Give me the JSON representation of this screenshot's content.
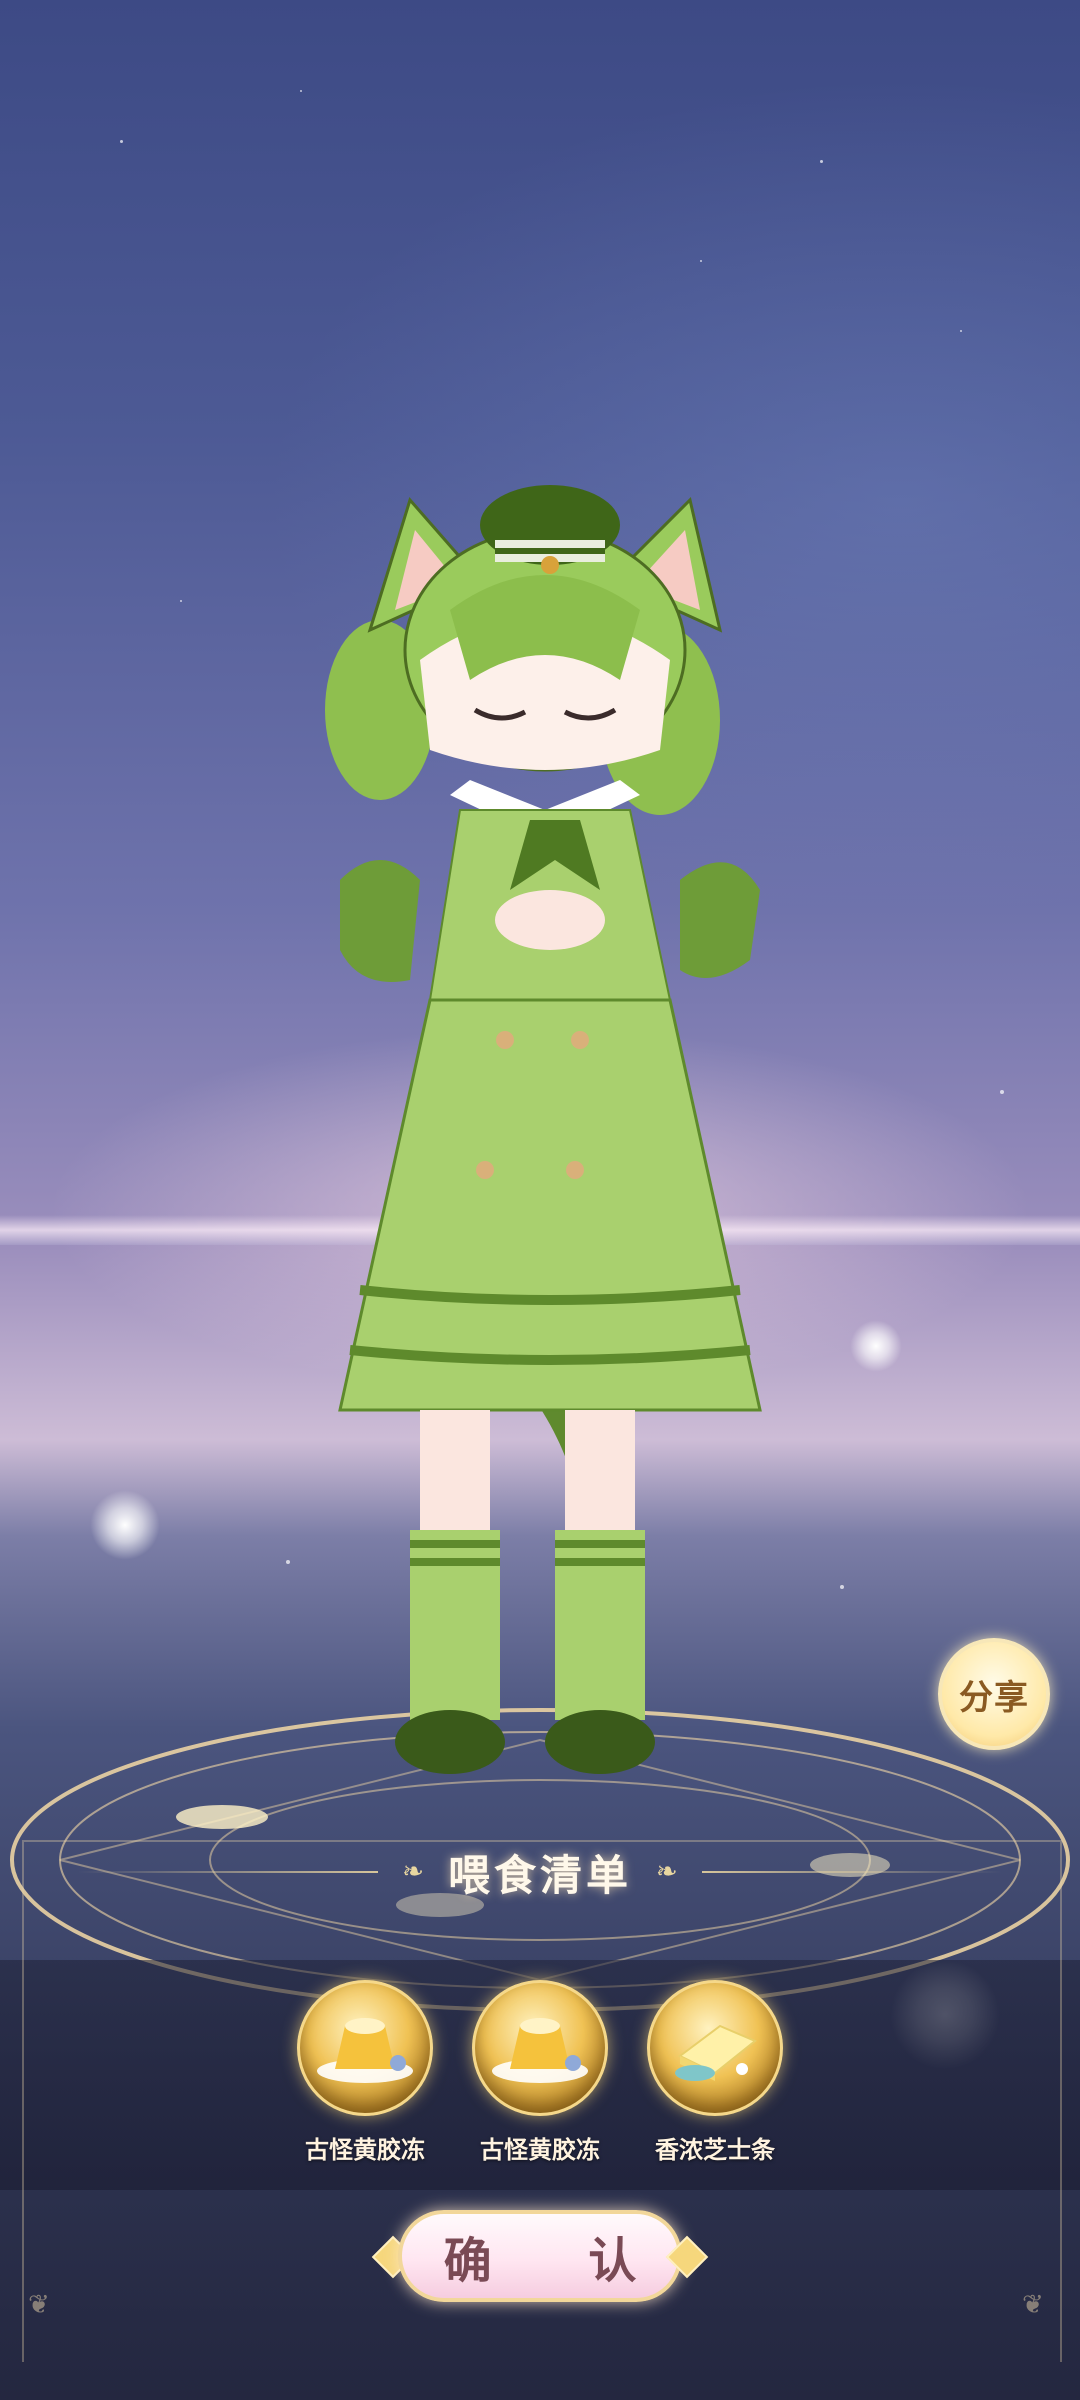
{
  "share_button": {
    "label": "分享"
  },
  "feed_panel": {
    "title": "喂食清单",
    "items": [
      {
        "name": "古怪黄胶冻",
        "icon": "pudding-icon"
      },
      {
        "name": "古怪黄胶冻",
        "icon": "pudding-icon"
      },
      {
        "name": "香浓芝士条",
        "icon": "cheese-icon"
      }
    ],
    "confirm_label": "确 认"
  },
  "colors": {
    "accent_gold": "#f2d79a",
    "title_text": "#fff8ea",
    "confirm_text": "#7a4a55"
  }
}
